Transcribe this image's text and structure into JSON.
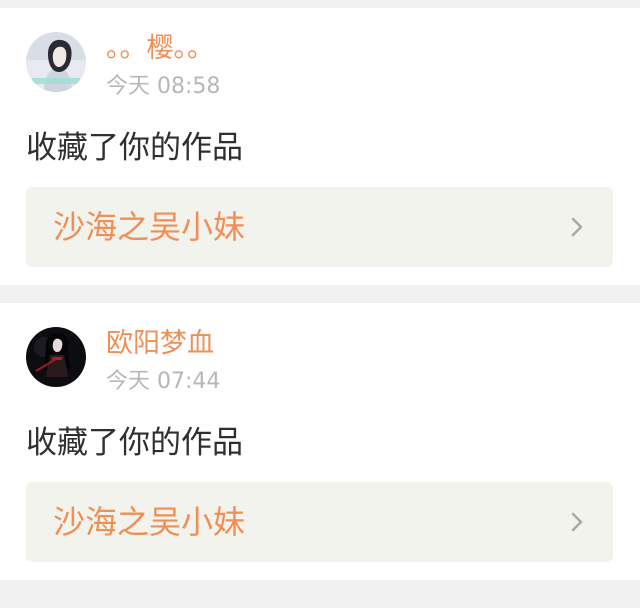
{
  "notifications": [
    {
      "user": "。。樱。。",
      "time": "今天 08:58",
      "action": "收藏了你的作品",
      "work_title": "沙海之吴小妹"
    },
    {
      "user": "欧阳梦血",
      "time": "今天 07:44",
      "action": "收藏了你的作品",
      "work_title": "沙海之吴小妹"
    }
  ],
  "colors": {
    "accent": "#f08f55",
    "muted": "#b7b7b7",
    "text": "#2f2f2f",
    "card_bg": "#ffffff",
    "page_bg": "#f1f1f1",
    "link_bg": "#f3f3ee"
  },
  "icons": {
    "link_arrow": "chevron-right-icon"
  }
}
